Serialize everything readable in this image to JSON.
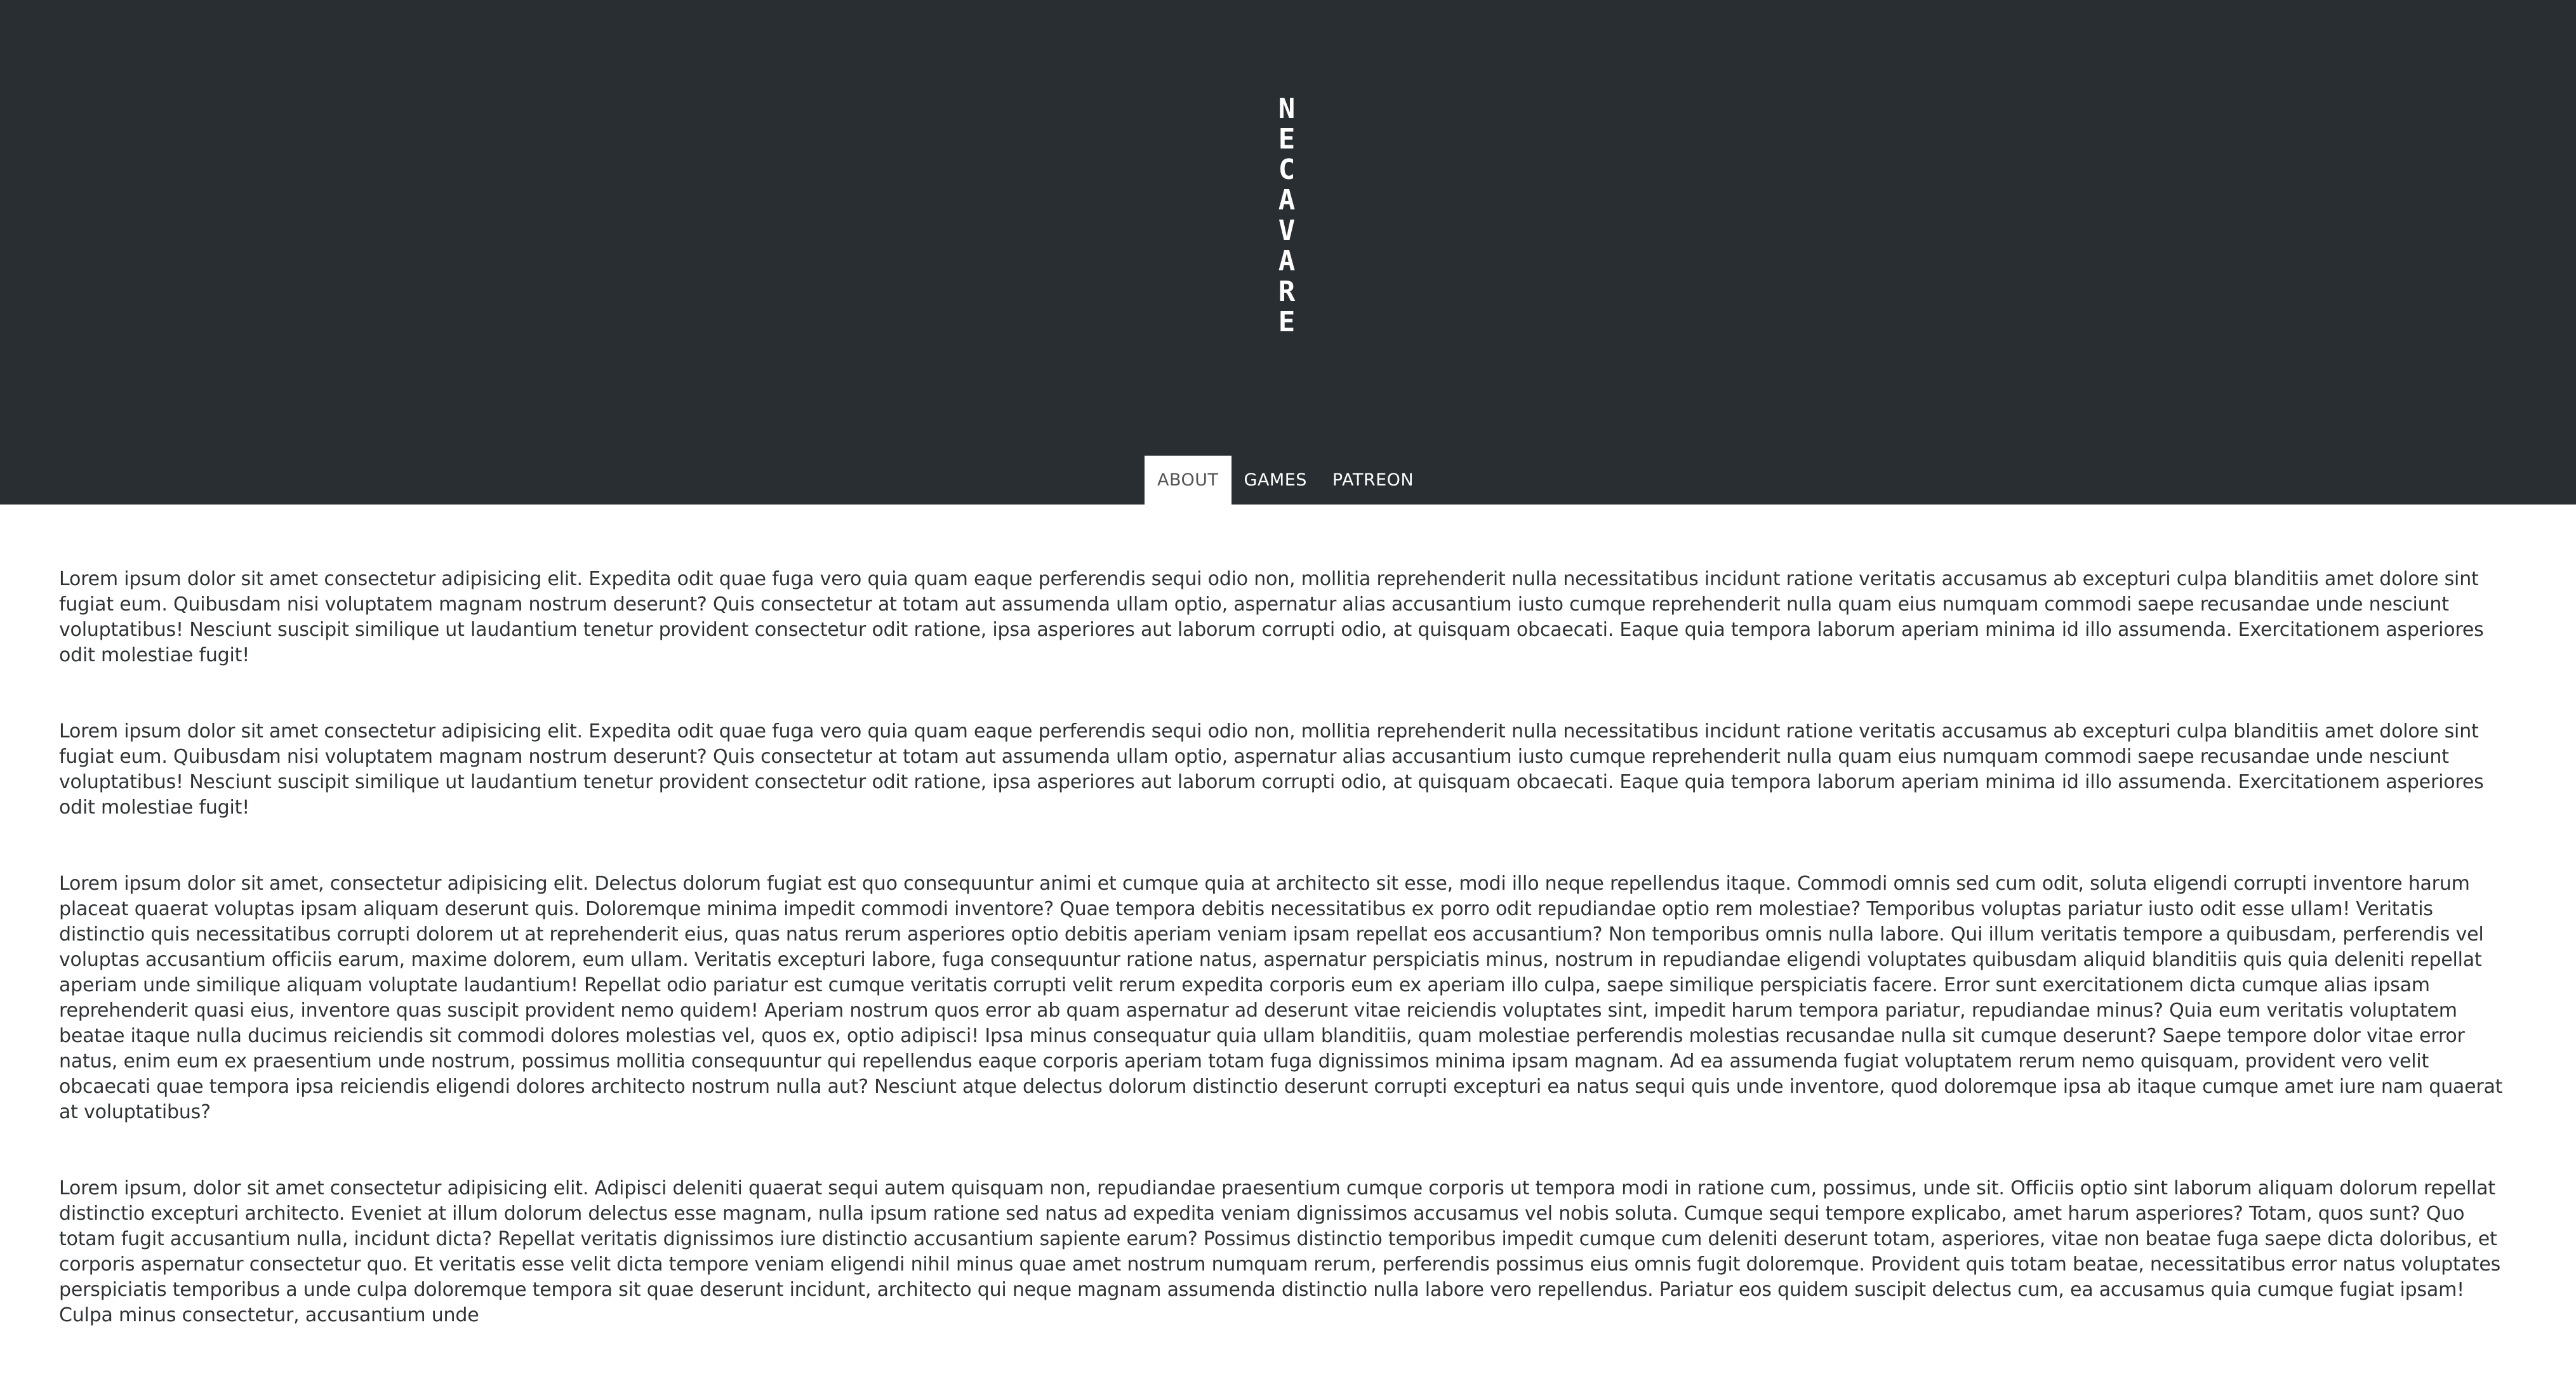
{
  "brand": {
    "logo_letters": [
      "N",
      "E",
      "C",
      "A",
      "V",
      "A",
      "R",
      "E"
    ]
  },
  "nav": {
    "items": [
      {
        "label": "ABOUT"
      },
      {
        "label": "GAMES"
      },
      {
        "label": "PATREON"
      }
    ]
  },
  "content": {
    "paragraphs": [
      "Lorem ipsum dolor sit amet consectetur adipisicing elit. Expedita odit quae fuga vero quia quam eaque perferendis sequi odio non, mollitia reprehenderit nulla necessitatibus incidunt ratione veritatis accusamus ab excepturi culpa blanditiis amet dolore sint fugiat eum. Quibusdam nisi voluptatem magnam nostrum deserunt? Quis consectetur at totam aut assumenda ullam optio, aspernatur alias accusantium iusto cumque reprehenderit nulla quam eius numquam commodi saepe recusandae unde nesciunt voluptatibus! Nesciunt suscipit similique ut laudantium tenetur provident consectetur odit ratione, ipsa asperiores aut laborum corrupti odio, at quisquam obcaecati. Eaque quia tempora laborum aperiam minima id illo assumenda. Exercitationem asperiores odit molestiae fugit!",
      "Lorem ipsum dolor sit amet consectetur adipisicing elit. Expedita odit quae fuga vero quia quam eaque perferendis sequi odio non, mollitia reprehenderit nulla necessitatibus incidunt ratione veritatis accusamus ab excepturi culpa blanditiis amet dolore sint fugiat eum. Quibusdam nisi voluptatem magnam nostrum deserunt? Quis consectetur at totam aut assumenda ullam optio, aspernatur alias accusantium iusto cumque reprehenderit nulla quam eius numquam commodi saepe recusandae unde nesciunt voluptatibus! Nesciunt suscipit similique ut laudantium tenetur provident consectetur odit ratione, ipsa asperiores aut laborum corrupti odio, at quisquam obcaecati. Eaque quia tempora laborum aperiam minima id illo assumenda. Exercitationem asperiores odit molestiae fugit!",
      "Lorem ipsum dolor sit amet, consectetur adipisicing elit. Delectus dolorum fugiat est quo consequuntur animi et cumque quia at architecto sit esse, modi illo neque repellendus itaque. Commodi omnis sed cum odit, soluta eligendi corrupti inventore harum placeat quaerat voluptas ipsam aliquam deserunt quis. Doloremque minima impedit commodi inventore? Quae tempora debitis necessitatibus ex porro odit repudiandae optio rem molestiae? Temporibus voluptas pariatur iusto odit esse ullam! Veritatis distinctio quis necessitatibus corrupti dolorem ut at reprehenderit eius, quas natus rerum asperiores optio debitis aperiam veniam ipsam repellat eos accusantium? Non temporibus omnis nulla labore. Qui illum veritatis tempore a quibusdam, perferendis vel voluptas accusantium officiis earum, maxime dolorem, eum ullam. Veritatis excepturi labore, fuga consequuntur ratione natus, aspernatur perspiciatis minus, nostrum in repudiandae eligendi voluptates quibusdam aliquid blanditiis quis quia deleniti repellat aperiam unde similique aliquam voluptate laudantium! Repellat odio pariatur est cumque veritatis corrupti velit rerum expedita corporis eum ex aperiam illo culpa, saepe similique perspiciatis facere. Error sunt exercitationem dicta cumque alias ipsam reprehenderit quasi eius, inventore quas suscipit provident nemo quidem! Aperiam nostrum quos error ab quam aspernatur ad deserunt vitae reiciendis voluptates sint, impedit harum tempora pariatur, repudiandae minus? Quia eum veritatis voluptatem beatae itaque nulla ducimus reiciendis sit commodi dolores molestias vel, quos ex, optio adipisci! Ipsa minus consequatur quia ullam blanditiis, quam molestiae perferendis molestias recusandae nulla sit cumque deserunt? Saepe tempore dolor vitae error natus, enim eum ex praesentium unde nostrum, possimus mollitia consequuntur qui repellendus eaque corporis aperiam totam fuga dignissimos minima ipsam magnam. Ad ea assumenda fugiat voluptatem rerum nemo quisquam, provident vero velit obcaecati quae tempora ipsa reiciendis eligendi dolores architecto nostrum nulla aut? Nesciunt atque delectus dolorum distinctio deserunt corrupti excepturi ea natus sequi quis unde inventore, quod doloremque ipsa ab itaque cumque amet iure nam quaerat at voluptatibus?",
      "Lorem ipsum, dolor sit amet consectetur adipisicing elit. Adipisci deleniti quaerat sequi autem quisquam non, repudiandae praesentium cumque corporis ut tempora modi in ratione cum, possimus, unde sit. Officiis optio sint laborum aliquam dolorum repellat distinctio excepturi architecto. Eveniet at illum dolorum delectus esse magnam, nulla ipsum ratione sed natus ad expedita veniam dignissimos accusamus vel nobis soluta. Cumque sequi tempore explicabo, amet harum asperiores? Totam, quos sunt? Quo totam fugit accusantium nulla, incidunt dicta? Repellat veritatis dignissimos iure distinctio accusantium sapiente earum? Possimus distinctio temporibus impedit cumque cum deleniti deserunt totam, asperiores, vitae non beatae fuga saepe dicta doloribus, et corporis aspernatur consectetur quo. Et veritatis esse velit dicta tempore veniam eligendi nihil minus quae amet nostrum numquam rerum, perferendis possimus eius omnis fugit doloremque. Provident quis totam beatae, necessitatibus error natus voluptates perspiciatis temporibus a unde culpa doloremque tempora sit quae deserunt incidunt, architecto qui neque magnam assumenda distinctio nulla labore vero repellendus. Pariatur eos quidem suscipit delectus cum, ea accusamus quia cumque fugiat ipsam! Culpa minus consectetur, accusantium unde"
    ]
  }
}
